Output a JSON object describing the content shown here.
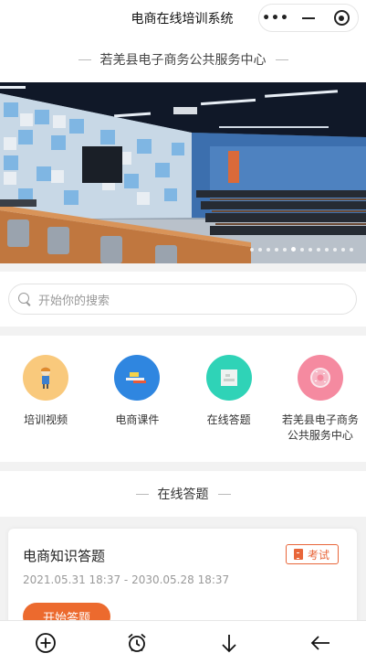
{
  "topbar": {
    "title": "电商在线培训系统",
    "capsule": {
      "more_icon": "more-dots-icon",
      "minimize_icon": "minus-icon",
      "close_icon": "target-circle-icon"
    }
  },
  "header": {
    "center_title": "若羌县电子商务公共服务中心"
  },
  "banner": {
    "alt_subject": "training-room-photo",
    "indicator_count": 13,
    "active_index": 5
  },
  "search": {
    "placeholder": "开始你的搜索",
    "icon": "search-icon"
  },
  "menu": {
    "items": [
      {
        "label": "培训视频",
        "icon": "person-icon",
        "color": "#f9c97c"
      },
      {
        "label": "电商课件",
        "icon": "courseware-icon",
        "color": "#2f86e0"
      },
      {
        "label": "在线答题",
        "icon": "document-icon",
        "color": "#2fd3b7"
      },
      {
        "label": "若羌县电子商务公共服务中心",
        "icon": "donut-icon",
        "color": "#f58aa0"
      }
    ]
  },
  "quiz_section": {
    "title": "在线答题",
    "card": {
      "title": "电商知识答题",
      "badge": "考试",
      "date_range": "2021.05.31 18:37 - 2030.05.28 18:37",
      "start_label": "开始答题"
    }
  },
  "toolbar": {
    "items": [
      {
        "icon": "plus-circle-icon"
      },
      {
        "icon": "alarm-clock-icon"
      },
      {
        "icon": "arrow-down-icon"
      },
      {
        "icon": "arrow-left-icon"
      }
    ]
  },
  "colors": {
    "accent": "#ec6a2e",
    "badge": "#e8663a",
    "background": "#f2f2f2"
  }
}
